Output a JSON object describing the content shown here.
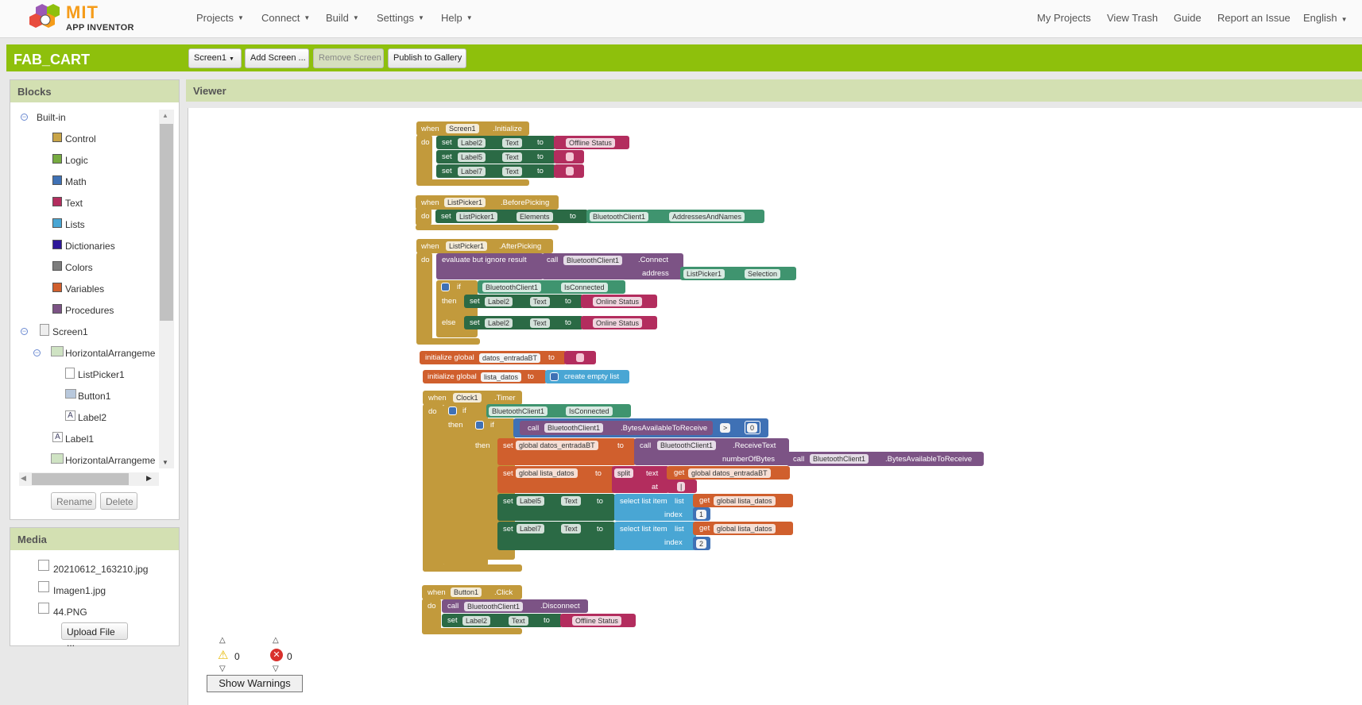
{
  "app": {
    "logo_line1": "MIT",
    "logo_line2": "APP INVENTOR"
  },
  "topmenu": {
    "items": [
      "Projects",
      "Connect",
      "Build",
      "Settings",
      "Help"
    ],
    "right": [
      "My Projects",
      "View Trash",
      "Guide",
      "Report an Issue",
      "English"
    ]
  },
  "project": {
    "name": "FAB_CART",
    "screen_select": "Screen1",
    "add_screen": "Add Screen ...",
    "remove_screen": "Remove Screen",
    "publish": "Publish to Gallery"
  },
  "blocks_panel": {
    "title": "Blocks",
    "builtin_label": "Built-in",
    "builtin": [
      {
        "label": "Control",
        "color": "#c8a447"
      },
      {
        "label": "Logic",
        "color": "#77ab41"
      },
      {
        "label": "Math",
        "color": "#3f71b5"
      },
      {
        "label": "Text",
        "color": "#b32d5e"
      },
      {
        "label": "Lists",
        "color": "#49a6d4"
      },
      {
        "label": "Dictionaries",
        "color": "#2d1799"
      },
      {
        "label": "Colors",
        "color": "#7d7d7d"
      },
      {
        "label": "Variables",
        "color": "#d05f2d"
      },
      {
        "label": "Procedures",
        "color": "#7c5385"
      }
    ],
    "components": {
      "screen": "Screen1",
      "arr1": "HorizontalArrangeme",
      "listpicker": "ListPicker1",
      "button": "Button1",
      "label2": "Label2",
      "label1": "Label1",
      "arr2": "HorizontalArrangeme"
    },
    "rename": "Rename",
    "delete": "Delete"
  },
  "media_panel": {
    "title": "Media",
    "files": [
      "20210612_163210.jpg",
      "Imagen1.jpg",
      "44.PNG"
    ],
    "upload": "Upload File ..."
  },
  "viewer": {
    "title": "Viewer",
    "warnings_count": "0",
    "errors_count": "0",
    "show_warnings": "Show Warnings"
  },
  "blocks": {
    "when": "when",
    "do": "do",
    "set": "set",
    "to": "to",
    "call": "call",
    "then": "then",
    "else": "else",
    "if": "if",
    "get": "get",
    "dot_text": "Text",
    "b1": {
      "comp": "Screen1",
      "event": ".Initialize",
      "l2": "Label2",
      "l5": "Label5",
      "l7": "Label7",
      "str": "Offline Status"
    },
    "b2": {
      "comp": "ListPicker1",
      "event": ".BeforePicking",
      "prop": "Elements",
      "bt": "BluetoothClient1",
      "prop2": "AddressesAndNames"
    },
    "b3": {
      "comp": "ListPicker1",
      "event": ".AfterPicking",
      "eval": "evaluate but ignore result",
      "bt": "BluetoothClient1",
      "method": ".Connect",
      "address": "address",
      "lp": "ListPicker1",
      "sel": "Selection",
      "isconn": "IsConnected",
      "label": "Label2",
      "online": "Online Status"
    },
    "b4": {
      "init": "initialize global",
      "var": "datos_entradaBT"
    },
    "b5": {
      "init": "initialize global",
      "var": "lista_datos",
      "empty": "create empty list"
    },
    "b6": {
      "comp": "Clock1",
      "event": ".Timer",
      "bt": "BluetoothClient1",
      "isconn": "IsConnected",
      "bytes": ".BytesAvailableToReceive",
      "gt": ">",
      "zero": "0",
      "gdatos": "global datos_entradaBT",
      "receive": ".ReceiveText",
      "nbytes": "numberOfBytes",
      "glista": "global lista_datos",
      "split": "split",
      "text": "text",
      "at": "at",
      "sep": "|",
      "l5": "Label5",
      "l7": "Label7",
      "select": "select list item",
      "list": "list",
      "index": "index",
      "i1": "1",
      "i2": "2"
    },
    "b7": {
      "comp": "Button1",
      "event": ".Click",
      "bt": "BluetoothClient1",
      "method": ".Disconnect",
      "label": "Label2",
      "str": "Offline Status"
    }
  }
}
